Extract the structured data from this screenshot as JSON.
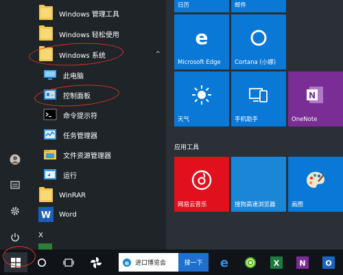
{
  "app_list": {
    "items": [
      {
        "label": "Windows 管理工具",
        "icon": "folder-icon",
        "caret": ""
      },
      {
        "label": "Windows 轻松使用",
        "icon": "folder-icon",
        "caret": ""
      },
      {
        "label": "Windows 系统",
        "icon": "folder-icon",
        "caret": "^"
      },
      {
        "label": "此电脑",
        "icon": "computer-icon",
        "caret": ""
      },
      {
        "label": "控制面板",
        "icon": "control-panel-icon",
        "caret": ""
      },
      {
        "label": "命令提示符",
        "icon": "command-prompt-icon",
        "caret": ""
      },
      {
        "label": "任务管理器",
        "icon": "task-manager-icon",
        "caret": ""
      },
      {
        "label": "文件资源管理器",
        "icon": "file-explorer-icon",
        "caret": ""
      },
      {
        "label": "运行",
        "icon": "run-icon",
        "caret": ""
      },
      {
        "label": "WinRAR",
        "icon": "folder-icon",
        "caret": ""
      },
      {
        "label": "Word",
        "icon": "word-icon",
        "caret": ""
      }
    ],
    "section_letter": "X"
  },
  "tiles": {
    "top_labels": {
      "calendar": "日历",
      "mail": "邮件"
    },
    "row1": {
      "edge": "Microsoft Edge",
      "cortana": "Cortana (小娜)"
    },
    "row2": {
      "weather": "天气",
      "phone": "手机助手",
      "onenote": "OneNote"
    },
    "group_title": "应用工具",
    "row3": {
      "music": "网易云音乐",
      "sogou": "搜狗高速浏览器",
      "paint": "画图"
    }
  },
  "taskbar": {
    "search_value": "进口博览会",
    "search_button": "搜一下"
  },
  "colors": {
    "tile_blue": "#0a78d7",
    "onenote": "#7a2d95",
    "music_red": "#e0101c",
    "sogou_blue": "#1b86d6",
    "annotation_red": "#d6332a"
  }
}
